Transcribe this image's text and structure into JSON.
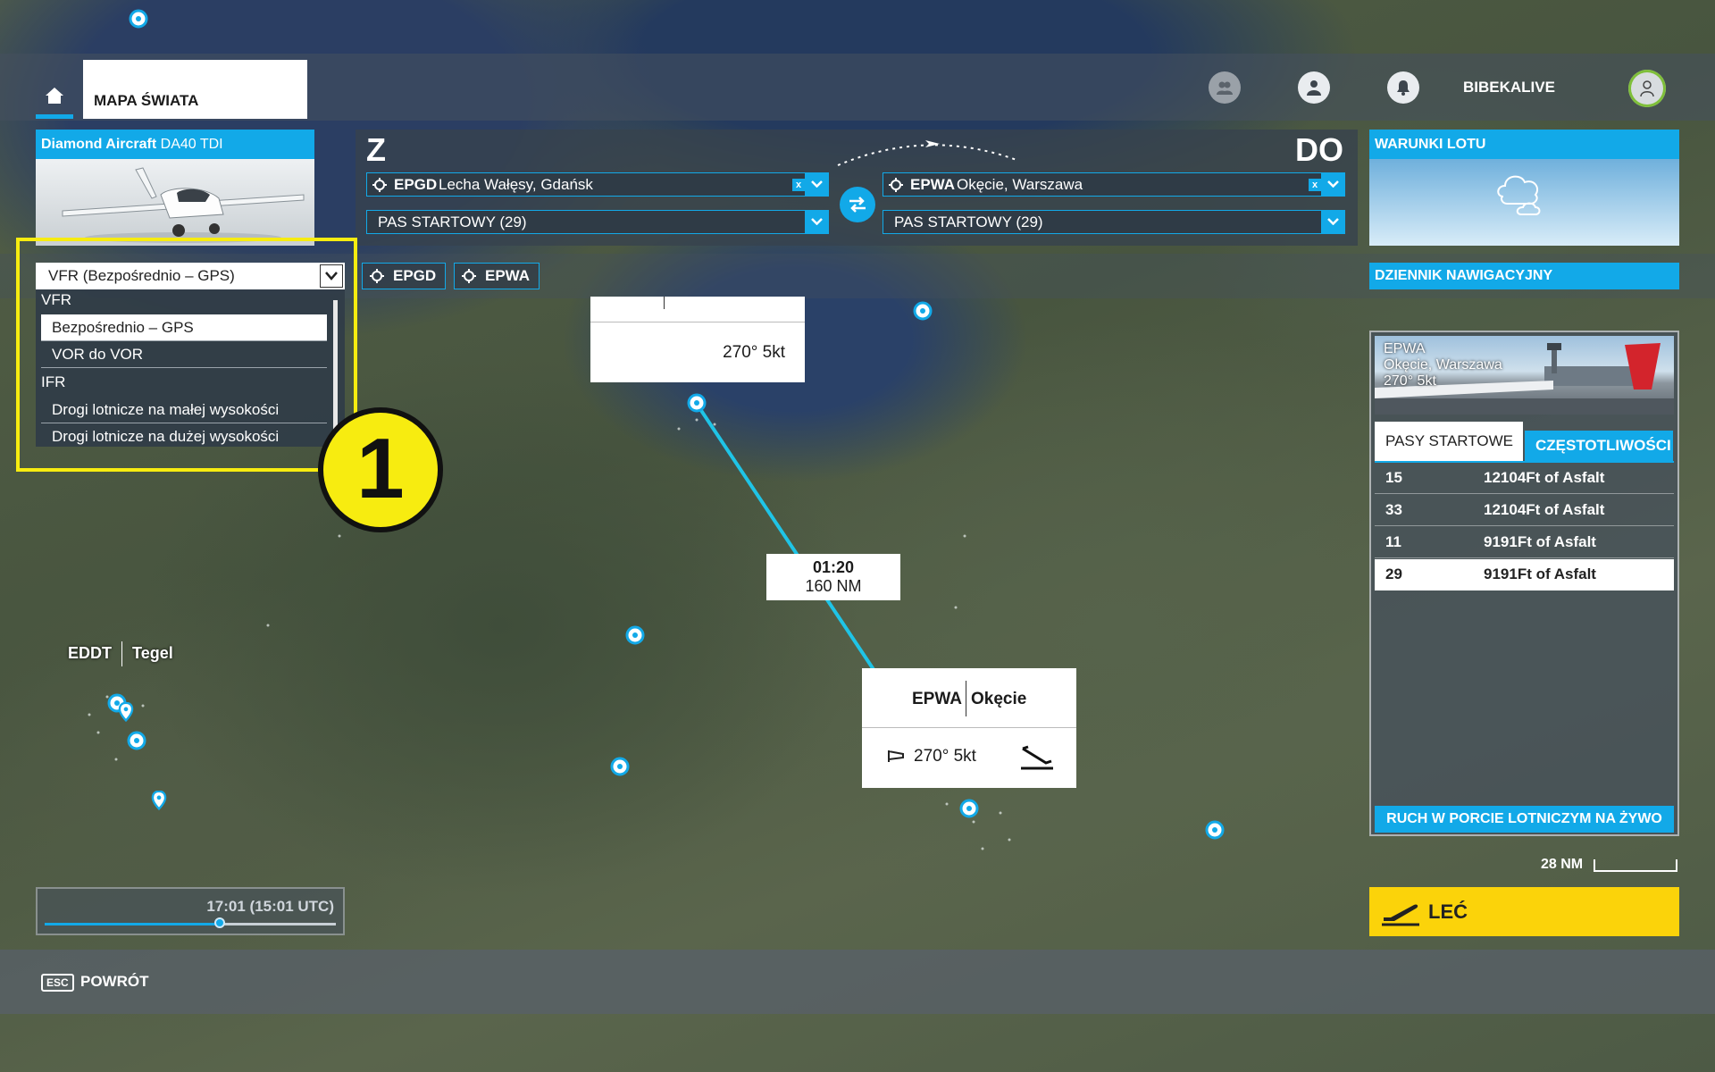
{
  "topbar": {
    "world_map_tab": "MAPA ŚWIATA",
    "username": "BIBEKALIVE"
  },
  "aircraft": {
    "brand": "Diamond Aircraft",
    "model": "DA40 TDI"
  },
  "route": {
    "from_letter": "Z",
    "to_letter": "DO",
    "departure": {
      "code": "EPGD",
      "name": "Lecha Wałęsy, Gdańsk",
      "runway": "PAS STARTOWY (29)"
    },
    "arrival": {
      "code": "EPWA",
      "name": "Okęcie, Warszawa",
      "runway": "PAS STARTOWY (29)"
    },
    "clear_symbol": "x"
  },
  "conditions": {
    "title": "WARUNKI LOTU"
  },
  "flight_type": {
    "selected": "VFR (Bezpośrednio – GPS)",
    "groups": [
      {
        "label": "VFR",
        "items": [
          "Bezpośrednio – GPS",
          "VOR do VOR"
        ]
      },
      {
        "label": "IFR",
        "items": [
          "Drogi lotnicze na małej wysokości",
          "Drogi lotnicze na dużej wysokości"
        ]
      }
    ],
    "selected_item": "Bezpośrednio – GPS"
  },
  "waypoints": [
    "EPGD",
    "EPWA"
  ],
  "nav_log": "DZIENNIK NAWIGACYJNY",
  "step_badge": "1",
  "map": {
    "origin_wind": "270° 5kt",
    "leg_time": "01:20",
    "leg_distance": "160 NM",
    "dest_code": "EPWA",
    "dest_name": "Okęcie",
    "dest_wind": "270° 5kt",
    "eddt_code": "EDDT",
    "eddt_name": "Tegel"
  },
  "airport_panel": {
    "code": "EPWA",
    "name": "Okęcie, Warszawa",
    "wind": "270° 5kt",
    "tab_runways": "PASY STARTOWE",
    "tab_frequencies": "CZĘSTOTLIWOŚCI",
    "runways": [
      {
        "number": "15",
        "length": "12104Ft of Asfalt",
        "selected": false
      },
      {
        "number": "33",
        "length": "12104Ft of Asfalt",
        "selected": false
      },
      {
        "number": "11",
        "length": "9191Ft of Asfalt",
        "selected": false
      },
      {
        "number": "29",
        "length": "9191Ft of Asfalt",
        "selected": true
      }
    ],
    "live_traffic": "RUCH W PORCIE LOTNICZYM NA ŻYWO"
  },
  "scale": "28 NM",
  "fly_button": "LEĆ",
  "time": {
    "label": "17:01 (15:01 UTC)",
    "fraction": 0.6
  },
  "bottom": {
    "esc_key": "ESC",
    "back_label": "POWRÓT"
  },
  "colors": {
    "accent": "#12a9e8",
    "fly": "#fbd30a",
    "highlight": "#f7ec10"
  }
}
